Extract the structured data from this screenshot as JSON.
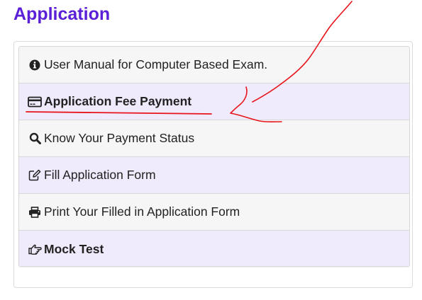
{
  "page": {
    "title": "Application"
  },
  "menu": {
    "items": [
      {
        "label": "User Manual for Computer Based Exam.",
        "icon": "info-circle-icon"
      },
      {
        "label": "Application Fee Payment",
        "icon": "credit-card-icon"
      },
      {
        "label": "Know Your Payment Status",
        "icon": "search-icon"
      },
      {
        "label": "Fill Application Form",
        "icon": "edit-icon"
      },
      {
        "label": "Print Your Filled in Application Form",
        "icon": "print-icon"
      },
      {
        "label": "Mock Test",
        "icon": "hand-pointing-icon"
      }
    ]
  },
  "colors": {
    "title": "#5a1fd6",
    "row_light": "#f6f6f6",
    "row_lavender": "#efeafc",
    "annotation_ink": "#e8141b"
  }
}
